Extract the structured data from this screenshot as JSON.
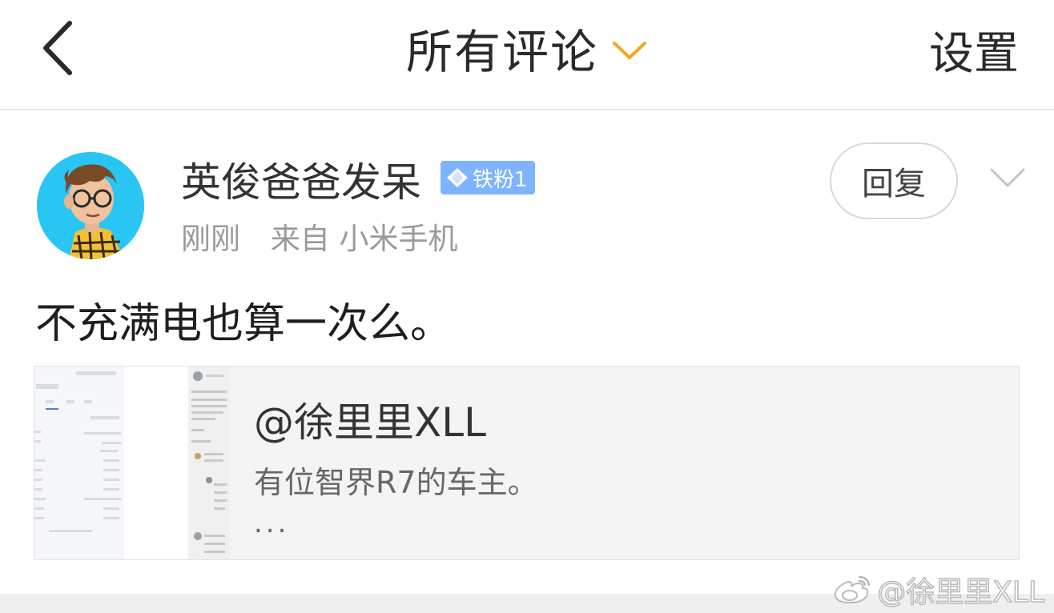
{
  "header": {
    "title": "所有评论",
    "settings_label": "设置",
    "accent_color": "#f5a623"
  },
  "comment": {
    "username": "英俊爸爸发呆",
    "badge": "铁粉1",
    "time": "刚刚",
    "source": "来自 小米手机",
    "reply_label": "回复",
    "text": "不充满电也算一次么。"
  },
  "quote": {
    "author": "@徐里里XLL",
    "text": "有位智界R7的车主。",
    "ellipsis": "..."
  },
  "watermark": {
    "text": "@徐里里XLL"
  },
  "icons": {
    "back": "chevron-left-icon",
    "title_dropdown": "chevron-down-icon",
    "more": "chevron-down-icon",
    "badge": "diamond-icon",
    "watermark": "weibo-logo-icon"
  }
}
